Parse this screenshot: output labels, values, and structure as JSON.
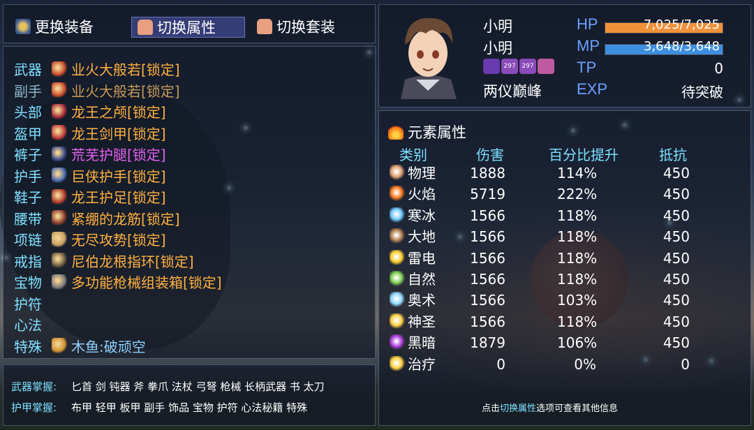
{
  "menu": {
    "change_equipment": "更换装备",
    "switch_attributes": "切换属性",
    "switch_set": "切换套装"
  },
  "slots": [
    {
      "label": "武器",
      "item": "业火大般若[锁定]",
      "icon": "weapon-icon",
      "style": "normal"
    },
    {
      "label": "副手",
      "item": "业火大般若[锁定]",
      "icon": "offhand-icon",
      "style": "dim"
    },
    {
      "label": "头部",
      "item": "龙王之颅[锁定]",
      "icon": "helmet-icon",
      "style": "normal"
    },
    {
      "label": "盔甲",
      "item": "龙王剑甲[锁定]",
      "icon": "armor-icon",
      "style": "normal"
    },
    {
      "label": "裤子",
      "item": "荒芜护腿[锁定]",
      "icon": "leggings-icon",
      "style": "purple"
    },
    {
      "label": "护手",
      "item": "巨侠护手[锁定]",
      "icon": "gauntlet-icon",
      "style": "normal"
    },
    {
      "label": "鞋子",
      "item": "龙王护足[锁定]",
      "icon": "boots-icon",
      "style": "normal"
    },
    {
      "label": "腰带",
      "item": "紧绷的龙筋[锁定]",
      "icon": "belt-icon",
      "style": "normal"
    },
    {
      "label": "项链",
      "item": "无尽攻势[锁定]",
      "icon": "necklace-icon",
      "style": "normal"
    },
    {
      "label": "戒指",
      "item": "尼伯龙根指环[锁定]",
      "icon": "ring-icon",
      "style": "normal"
    },
    {
      "label": "宝物",
      "item": "多功能枪械组装箱[锁定]",
      "icon": "treasure-icon",
      "style": "normal"
    },
    {
      "label": "护符",
      "item": "",
      "icon": "",
      "style": "normal"
    },
    {
      "label": "心法",
      "item": "",
      "icon": "",
      "style": "normal"
    },
    {
      "label": "特殊",
      "item": "木鱼:破顽空",
      "icon": "wooden-fish-icon",
      "style": "blue"
    }
  ],
  "character": {
    "name": "小明",
    "nickname": "小明",
    "realm": "两仪巅峰",
    "badges": [
      "297",
      "297"
    ],
    "hp_label": "HP",
    "hp_text": "7,025/7,025",
    "hp_ratio": 1.0,
    "mp_label": "MP",
    "mp_text": "3,648/3,648",
    "mp_ratio": 1.0,
    "tp_label": "TP",
    "tp_value": "0",
    "exp_label": "EXP",
    "exp_value": "待突破"
  },
  "elements": {
    "title": "元素属性",
    "headers": {
      "type": "类别",
      "damage": "伤害",
      "percent": "百分比提升",
      "resist": "抵抗"
    },
    "rows": [
      {
        "name": "物理",
        "damage": "1888",
        "percent": "114%",
        "resist": "450",
        "icon": "fist-icon",
        "color": "#e0a070"
      },
      {
        "name": "火焰",
        "damage": "5719",
        "percent": "222%",
        "resist": "450",
        "icon": "fire-icon",
        "color": "#ff7a20"
      },
      {
        "name": "寒冰",
        "damage": "1566",
        "percent": "118%",
        "resist": "450",
        "icon": "snowflake-icon",
        "color": "#6fc8ff"
      },
      {
        "name": "大地",
        "damage": "1566",
        "percent": "118%",
        "resist": "450",
        "icon": "earth-icon",
        "color": "#b08050"
      },
      {
        "name": "雷电",
        "damage": "1566",
        "percent": "118%",
        "resist": "450",
        "icon": "lightning-icon",
        "color": "#ffd030"
      },
      {
        "name": "自然",
        "damage": "1566",
        "percent": "118%",
        "resist": "450",
        "icon": "leaf-icon",
        "color": "#7fd050"
      },
      {
        "name": "奥术",
        "damage": "1566",
        "percent": "103%",
        "resist": "450",
        "icon": "arcane-icon",
        "color": "#8fd8ff"
      },
      {
        "name": "神圣",
        "damage": "1566",
        "percent": "118%",
        "resist": "450",
        "icon": "holy-icon",
        "color": "#ffd040"
      },
      {
        "name": "黑暗",
        "damage": "1879",
        "percent": "106%",
        "resist": "450",
        "icon": "dark-icon",
        "color": "#b040e0"
      },
      {
        "name": "治疗",
        "damage": "0",
        "percent": "0%",
        "resist": "0",
        "icon": "heal-icon",
        "color": "#ffd040"
      }
    ]
  },
  "footer": {
    "weapon_label": "武器掌握:",
    "weapon_items": "匕首 剑 钝器 斧 拳爪 法杖 弓弩 枪械 长柄武器 书 太刀",
    "armor_label": "护甲掌握:",
    "armor_items": "布甲 轻甲 板甲 副手 饰品 宝物 护符 心法秘籍 特殊",
    "hint_prefix": "点击",
    "hint_highlight": "切换属性",
    "hint_suffix": "选项可查看其他信息"
  },
  "colors": {
    "hp_bar": "#f0913a",
    "mp_bar": "#3f8fe0",
    "label_cyan": "#7ee0ff",
    "item_orange": "#ffb040"
  }
}
